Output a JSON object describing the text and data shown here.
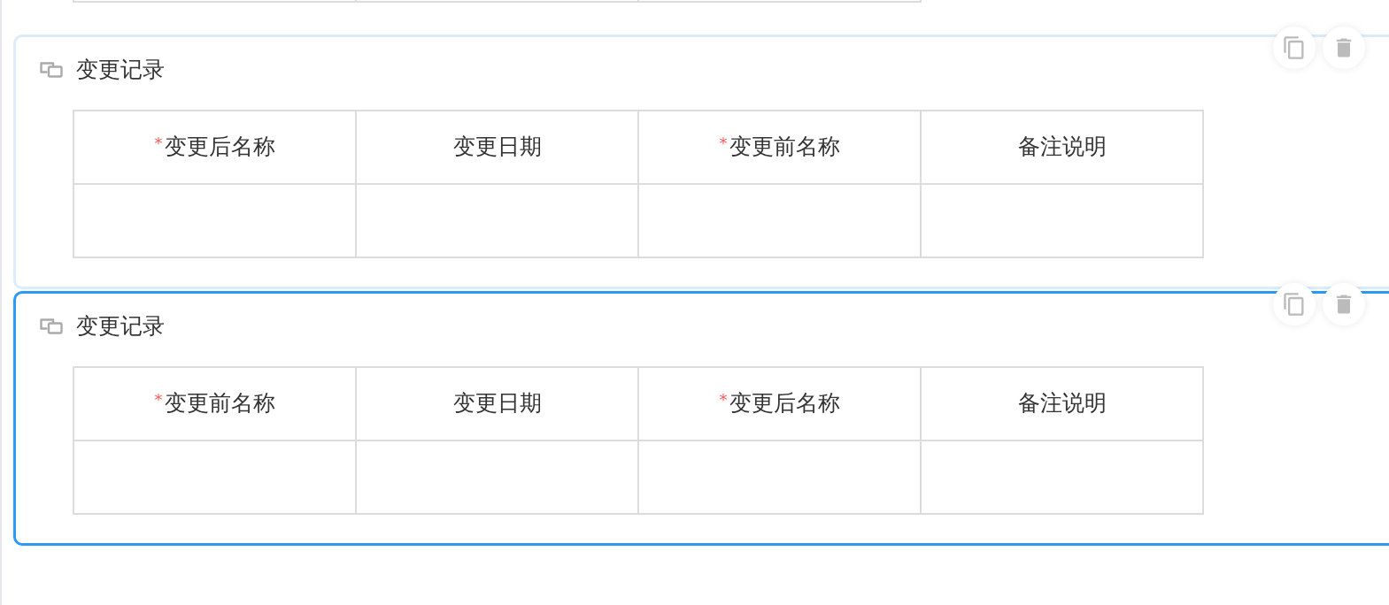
{
  "cards": [
    {
      "selected": false,
      "title": "变更记录",
      "table": {
        "columns": [
          {
            "required_mark": "*",
            "label": "变更后名称"
          },
          {
            "label": "变更日期"
          },
          {
            "required_mark": "*",
            "label": "变更前名称"
          },
          {
            "label": "备注说明"
          }
        ]
      }
    },
    {
      "selected": true,
      "title": "变更记录",
      "table": {
        "columns": [
          {
            "required_mark": "*",
            "label": "变更前名称"
          },
          {
            "label": "变更日期"
          },
          {
            "required_mark": "*",
            "label": "变更后名称"
          },
          {
            "label": "备注说明"
          }
        ]
      }
    }
  ]
}
